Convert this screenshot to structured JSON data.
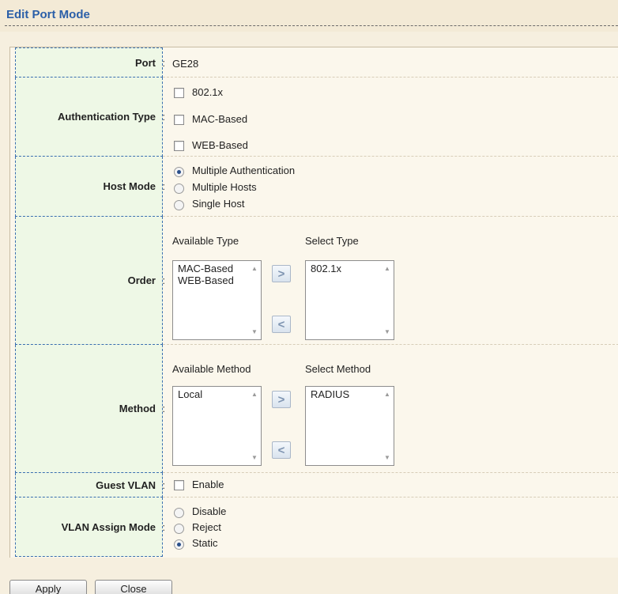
{
  "title": "Edit Port Mode",
  "port": {
    "label": "Port",
    "value": "GE28"
  },
  "authentication_type": {
    "label": "Authentication Type",
    "options": [
      "802.1x",
      "MAC-Based",
      "WEB-Based"
    ],
    "checked": [
      false,
      false,
      false
    ]
  },
  "host_mode": {
    "label": "Host Mode",
    "options": [
      "Multiple Authentication",
      "Multiple Hosts",
      "Single Host"
    ],
    "selected": "Multiple Authentication"
  },
  "order": {
    "label": "Order",
    "available_title": "Available Type",
    "select_title": "Select Type",
    "available": [
      "MAC-Based",
      "WEB-Based"
    ],
    "selected": [
      "802.1x"
    ]
  },
  "method": {
    "label": "Method",
    "available_title": "Available Method",
    "select_title": "Select Method",
    "available": [
      "Local"
    ],
    "selected": [
      "RADIUS"
    ]
  },
  "guest_vlan": {
    "label": "Guest VLAN",
    "option": "Enable",
    "checked": false
  },
  "vlan_assign_mode": {
    "label": "VLAN Assign Mode",
    "options": [
      "Disable",
      "Reject",
      "Static"
    ],
    "selected": "Static"
  },
  "icons": {
    "move_right": ">",
    "move_left": "<",
    "scroll_up": "▲",
    "scroll_down": "▼"
  },
  "buttons": {
    "apply": "Apply",
    "close": "Close"
  },
  "colors": {
    "title": "#2b5fa8",
    "label_bg": "#eef8e6",
    "label_border": "#3a6fb0",
    "page_bg": "#f6efdf"
  }
}
